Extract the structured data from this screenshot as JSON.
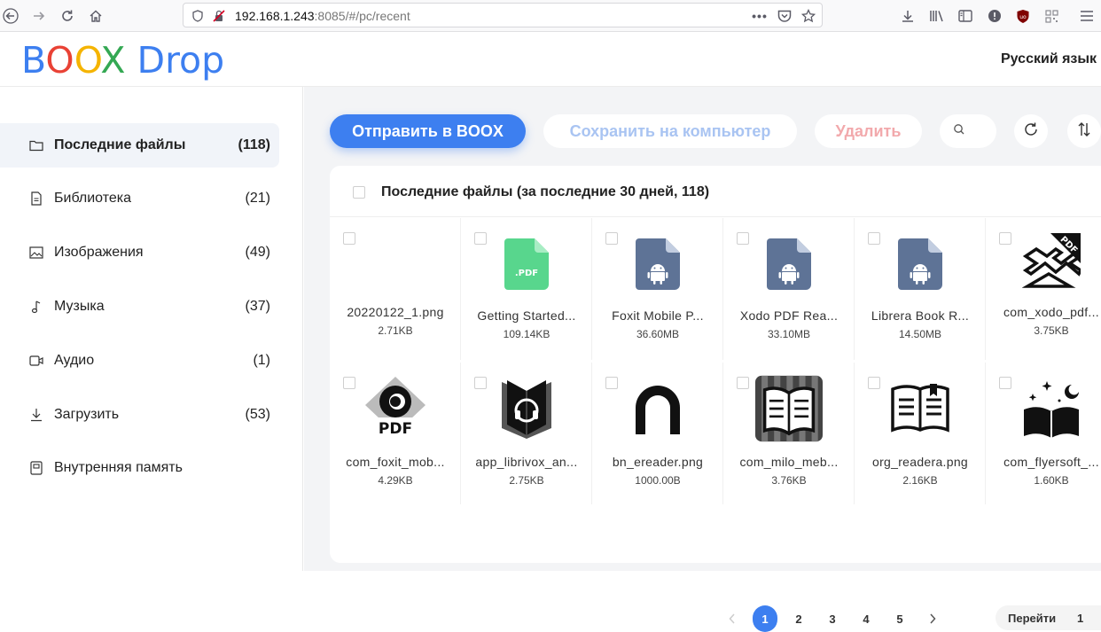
{
  "browser": {
    "url_host": "192.168.1.243",
    "url_rest": ":8085/#/pc/recent"
  },
  "header": {
    "logo_letters": [
      {
        "ch": "B",
        "color": "#3d7ff0"
      },
      {
        "ch": "O",
        "color": "#e94235"
      },
      {
        "ch": "O",
        "color": "#f5b400"
      },
      {
        "ch": "X",
        "color": "#34a853"
      },
      {
        "ch": " ",
        "color": "#3d7ff0"
      },
      {
        "ch": "D",
        "color": "#3d7ff0"
      },
      {
        "ch": "r",
        "color": "#3d7ff0"
      },
      {
        "ch": "o",
        "color": "#3d7ff0"
      },
      {
        "ch": "p",
        "color": "#3d7ff0"
      }
    ],
    "language": "Русский язык"
  },
  "sidebar": {
    "items": [
      {
        "label": "Последние файлы",
        "count": "(118)",
        "icon": "folder-icon"
      },
      {
        "label": "Библиотека",
        "count": "(21)",
        "icon": "book-icon"
      },
      {
        "label": "Изображения",
        "count": "(49)",
        "icon": "image-icon"
      },
      {
        "label": "Музыка",
        "count": "(37)",
        "icon": "music-icon"
      },
      {
        "label": "Аудио",
        "count": "(1)",
        "icon": "audio-icon"
      },
      {
        "label": "Загрузить",
        "count": "(53)",
        "icon": "download-icon"
      },
      {
        "label": "Внутренняя память",
        "count": "",
        "icon": "storage-icon"
      }
    ]
  },
  "toolbar": {
    "send_label": "Отправить в BOOX",
    "save_label": "Сохранить на компьютер",
    "delete_label": "Удалить"
  },
  "panel": {
    "title": "Последние файлы (за последние 30 дней, 118)"
  },
  "files": [
    {
      "name": "20220122_1.png",
      "size": "2.71KB",
      "icon": "blank"
    },
    {
      "name": "Getting Started...",
      "size": "109.14KB",
      "icon": "pdf-file-icon"
    },
    {
      "name": "Foxit Mobile P...",
      "size": "36.60MB",
      "icon": "apk-file-icon"
    },
    {
      "name": "Xodo PDF Rea...",
      "size": "33.10MB",
      "icon": "apk-file-icon"
    },
    {
      "name": "Librera Book R...",
      "size": "14.50MB",
      "icon": "apk-file-icon"
    },
    {
      "name": "com_xodo_pdf...",
      "size": "3.75KB",
      "icon": "xodo-logo-icon"
    },
    {
      "name": "com_foxit_mob...",
      "size": "4.29KB",
      "icon": "foxit-logo-icon"
    },
    {
      "name": "app_librivox_an...",
      "size": "2.75KB",
      "icon": "librivox-logo-icon"
    },
    {
      "name": "bn_ereader.png",
      "size": "1000.00B",
      "icon": "nook-logo-icon"
    },
    {
      "name": "com_milo_meb...",
      "size": "3.76KB",
      "icon": "milo-book-icon"
    },
    {
      "name": "org_readera.png",
      "size": "2.16KB",
      "icon": "readera-book-icon"
    },
    {
      "name": "com_flyersoft_...",
      "size": "1.60KB",
      "icon": "flyersoft-book-icon"
    }
  ],
  "pagination": {
    "pages": [
      "1",
      "2",
      "3",
      "4",
      "5"
    ],
    "current": "1",
    "goto_label": "Перейти",
    "goto_value": "1"
  },
  "colors": {
    "accent": "#3d7ff0",
    "apk_tile": "#5e7396",
    "pdf_tile": "#58d68d"
  }
}
